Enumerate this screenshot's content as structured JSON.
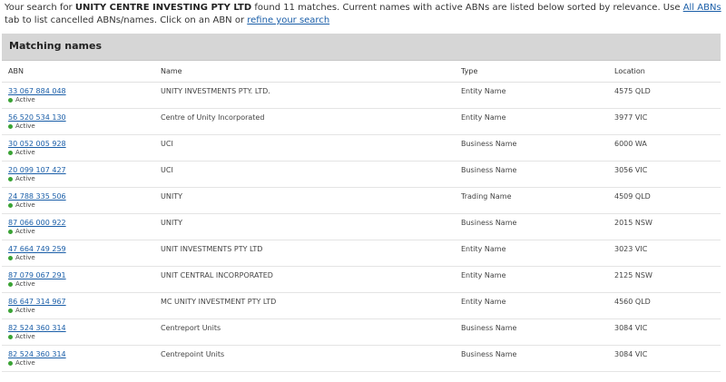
{
  "intro": {
    "prefix": "Your search for",
    "query": "UNITY CENTRE INVESTING PTY LTD",
    "middle": "found 11 matches. Current names with active ABNs are listed below sorted by relevance. Use",
    "all_abns_link": "All ABNs",
    "after_link": "tab to list cancelled ABNs/names. Click on an ABN or",
    "refine_link": "refine your search"
  },
  "panel": {
    "title": "Matching names"
  },
  "table": {
    "headers": {
      "abn": "ABN",
      "name": "Name",
      "type": "Type",
      "location": "Location"
    },
    "rows": [
      {
        "abn": "33 067 884 048",
        "status": "Active",
        "name": "UNITY INVESTMENTS PTY. LTD.",
        "type": "Entity Name",
        "location": "4575 QLD"
      },
      {
        "abn": "56 520 534 130",
        "status": "Active",
        "name": "Centre of Unity Incorporated",
        "type": "Entity Name",
        "location": "3977 VIC"
      },
      {
        "abn": "30 052 005 928",
        "status": "Active",
        "name": "UCI",
        "type": "Business Name",
        "location": "6000 WA"
      },
      {
        "abn": "20 099 107 427",
        "status": "Active",
        "name": "UCI",
        "type": "Business Name",
        "location": "3056 VIC"
      },
      {
        "abn": "24 788 335 506",
        "status": "Active",
        "name": "UNITY",
        "type": "Trading Name",
        "location": "4509 QLD"
      },
      {
        "abn": "87 066 000 922",
        "status": "Active",
        "name": "UNITY",
        "type": "Business Name",
        "location": "2015 NSW"
      },
      {
        "abn": "47 664 749 259",
        "status": "Active",
        "name": "UNIT INVESTMENTS PTY LTD",
        "type": "Entity Name",
        "location": "3023 VIC"
      },
      {
        "abn": "87 079 067 291",
        "status": "Active",
        "name": "UNIT CENTRAL INCORPORATED",
        "type": "Entity Name",
        "location": "2125 NSW"
      },
      {
        "abn": "86 647 314 967",
        "status": "Active",
        "name": "MC UNITY INVESTMENT PTY LTD",
        "type": "Entity Name",
        "location": "4560 QLD"
      },
      {
        "abn": "82 524 360 314",
        "status": "Active",
        "name": "Centreport Units",
        "type": "Business Name",
        "location": "3084 VIC"
      },
      {
        "abn": "82 524 360 314",
        "status": "Active",
        "name": "Centrepoint Units",
        "type": "Business Name",
        "location": "3084 VIC"
      }
    ]
  },
  "colors": {
    "link": "#1a5ea8",
    "active_dot": "#3aa335",
    "header_bg": "#d6d6d6"
  }
}
